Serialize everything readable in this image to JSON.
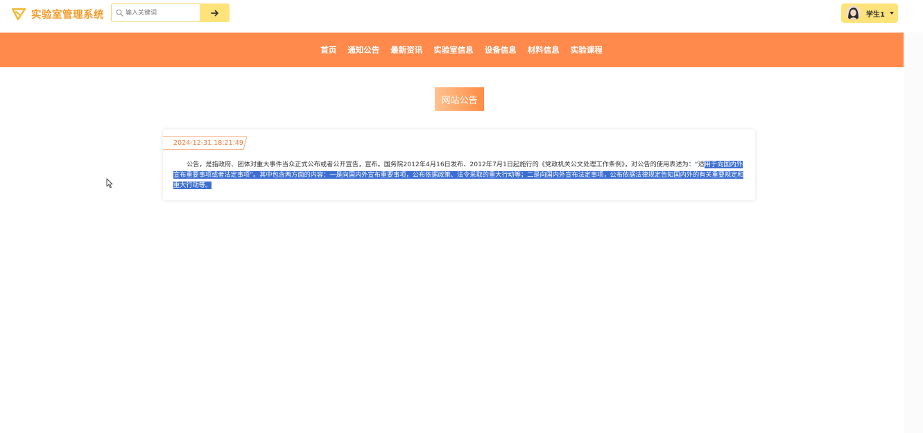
{
  "header": {
    "brand": "实验室管理系统",
    "search_placeholder": "输入关键词",
    "user_name": "学生1"
  },
  "nav": {
    "items": [
      "首页",
      "通知公告",
      "最新资讯",
      "实验室信息",
      "设备信息",
      "材料信息",
      "实验课程"
    ]
  },
  "section": {
    "title": "网站公告"
  },
  "notice": {
    "datetime": "2024-12-31 18:21:49",
    "text_plain": "公告，是指政府、团体对重大事件当众正式公布或者公开宣告，宣布。国务院2012年4月16日发布、2012年7月1日起施行的《党政机关公文处理工作条例》，对公告的使用表述为：“适",
    "text_selected": "用于向国内外宣布重要事项或者法定事项”。其中包含两方面的内容：一是向国内外宣布重要事项，公布依据政策、法令采取的重大行动等；二是向国内外宣布法定事项，公布依据法律规定告知国内外的有关重要规定和重大行动等。"
  },
  "colors": {
    "brand": "#f39c2b",
    "nav_bg": "#ff8a4b",
    "button_bg": "#fde37a",
    "selection": "#3c6fd1",
    "date_text": "#f07a3c"
  },
  "icons": {
    "logo": "paper-plane-icon",
    "search": "search-icon",
    "search_button": "arrow-right-icon",
    "dropdown": "caret-down-icon",
    "cursor": "mouse-pointer-icon"
  }
}
